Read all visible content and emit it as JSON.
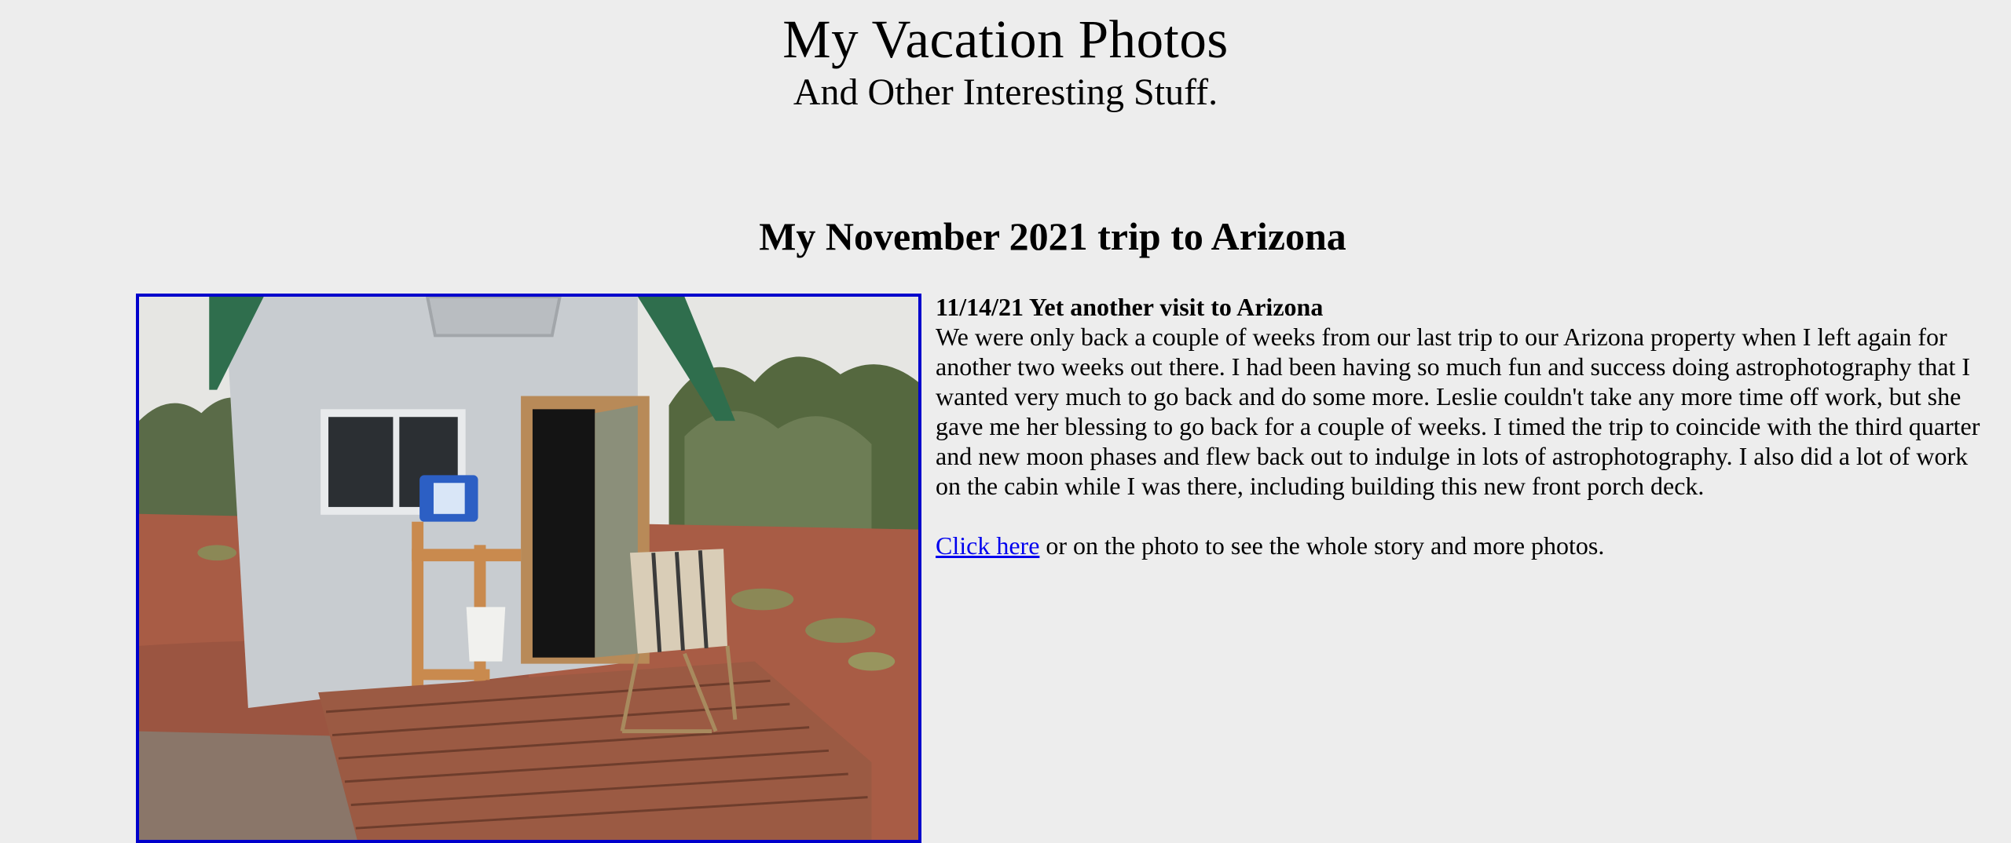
{
  "header": {
    "title": "My Vacation Photos",
    "subtitle": "And Other Interesting Stuff."
  },
  "main": {
    "heading": "My November 2021 trip to Arizona",
    "photo": {
      "alt": "Cabin with new front porch deck in Arizona"
    },
    "post": {
      "title": "11/14/21 Yet another visit to Arizona",
      "body": "We were only back a couple of weeks from our last trip to our Arizona property when I left again for another two weeks out there. I had been having so much fun and success doing astrophotography that I wanted very much to go back and do some more. Leslie couldn't take any more time off work, but she gave me her blessing to go back for a couple of weeks. I timed the trip to coincide with the third quarter and new moon phases and flew back out to indulge in lots of astrophotography. I also did a lot of work on the cabin while I was there, including building this new front porch deck.",
      "link_text": "Click here",
      "link_suffix": " or on the photo to see the whole story and more photos."
    }
  },
  "colors": {
    "background": "#ededed",
    "link": "#0000ee",
    "photo_border": "#0000cc"
  }
}
